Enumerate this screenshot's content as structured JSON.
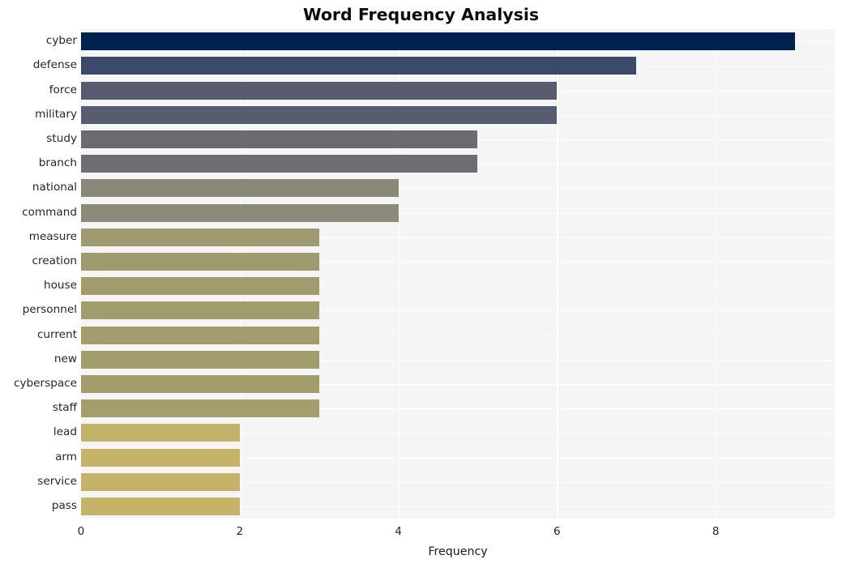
{
  "chart_data": {
    "type": "bar",
    "orientation": "horizontal",
    "title": "Word Frequency Analysis",
    "xlabel": "Frequency",
    "ylabel": "",
    "categories": [
      "cyber",
      "defense",
      "force",
      "military",
      "study",
      "branch",
      "national",
      "command",
      "measure",
      "creation",
      "house",
      "personnel",
      "current",
      "new",
      "cyberspace",
      "staff",
      "lead",
      "arm",
      "service",
      "pass"
    ],
    "values": [
      9,
      7,
      6,
      6,
      5,
      5,
      4,
      4,
      3,
      3,
      3,
      3,
      3,
      3,
      3,
      3,
      2,
      2,
      2,
      2
    ],
    "xlim": [
      0,
      9.5
    ],
    "xticks": [
      0,
      2,
      4,
      6,
      8
    ],
    "xticklabels": [
      "0",
      "2",
      "4",
      "6",
      "8"
    ],
    "grid": true,
    "grid_color": "#ffffff",
    "plot_background": "#f5f5f6",
    "figure_background": "#ffffff",
    "legend": null,
    "colormap": "cividis",
    "bar_colors": [
      "#00224e",
      "#3b4a6b",
      "#565b70",
      "#565d71",
      "#6a6c71",
      "#6d6e71",
      "#8a8878",
      "#8c8a79",
      "#9f9a6f",
      "#a09b6e",
      "#a09c6e",
      "#a19c6d",
      "#a19d6d",
      "#a29d6d",
      "#a29e6c",
      "#a39e6c",
      "#c3b269",
      "#c4b368",
      "#c4b368",
      "#c5b468"
    ]
  }
}
